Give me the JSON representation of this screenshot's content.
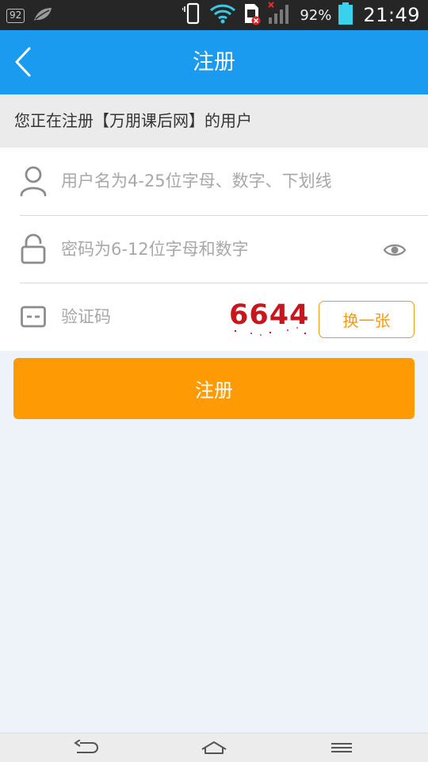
{
  "status_bar": {
    "notification_badge": "92",
    "battery_percent": "92%",
    "time": "21:49",
    "icons": [
      "leaf-icon",
      "vibrate-icon",
      "wifi-icon",
      "sim-error-icon",
      "signal-icon",
      "battery-icon"
    ]
  },
  "header": {
    "title": "注册",
    "back_icon": "chevron-left-icon"
  },
  "notice": {
    "text": "您正在注册【万朋课后网】的用户"
  },
  "form": {
    "username": {
      "placeholder": "用户名为4-25位字母、数字、下划线",
      "value": "",
      "icon": "user-icon"
    },
    "password": {
      "placeholder": "密码为6-12位字母和数字",
      "value": "",
      "icon": "lock-icon",
      "toggle_icon": "eye-icon"
    },
    "captcha": {
      "placeholder": "验证码",
      "value": "",
      "icon": "captcha-icon",
      "image_text": "6644",
      "refresh_label": "换一张"
    }
  },
  "submit_label": "注册",
  "colors": {
    "header": "#1a9bf0",
    "accent_orange": "#fd9a04",
    "captcha_red": "#c8171c",
    "background": "#eef2f9"
  },
  "nav_bar": {
    "icons": [
      "back-nav-icon",
      "home-nav-icon",
      "menu-nav-icon"
    ]
  }
}
